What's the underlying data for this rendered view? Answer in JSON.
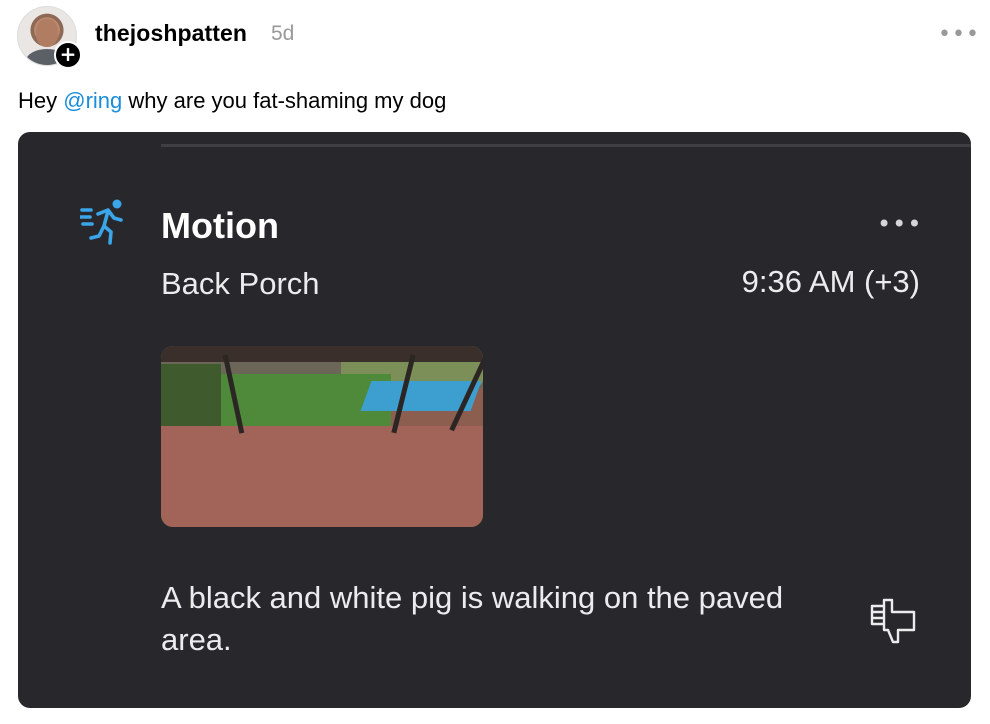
{
  "post": {
    "username": "thejoshpatten",
    "time_ago": "5d",
    "more_icon": "ellipsis-icon",
    "follow_icon": "plus-icon",
    "caption_prefix": "Hey ",
    "caption_mention": "@ring",
    "caption_suffix": " why are you fat-shaming my dog"
  },
  "card": {
    "icon": "running-person-icon",
    "title": "Motion",
    "location": "Back Porch",
    "time": "9:36 AM (+3)",
    "more_icon": "ellipsis-icon",
    "description": "A black and white pig is walking on the paved area.",
    "feedback_icon": "thumbs-down-icon"
  },
  "colors": {
    "mention": "#1a8ddb",
    "card_background": "#28282c",
    "motion_icon": "#3aa5e8"
  }
}
